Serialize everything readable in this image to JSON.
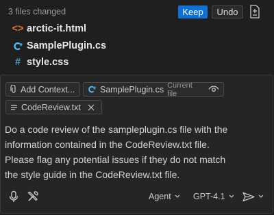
{
  "changes": {
    "label": "3 files changed",
    "keep_label": "Keep",
    "undo_label": "Undo",
    "files": [
      {
        "name": "arctic-it.html",
        "icon": "html-code-icon",
        "color": "#e37933"
      },
      {
        "name": "SamplePlugin.cs",
        "icon": "csharp-icon",
        "color": "#4fc1ff"
      },
      {
        "name": "style.css",
        "icon": "css-hash-icon",
        "color": "#519aba"
      }
    ]
  },
  "context": {
    "add_label": "Add Context...",
    "current_file_name": "SamplePlugin.cs",
    "current_file_tag": "Current file",
    "attached_file_name": "CodeReview.txt"
  },
  "prompt": {
    "lines": [
      "Do a code review of the sampleplugin.cs file with the",
      "information contained in the CodeReview.txt file.",
      "Please flag any potential issues if they do not match",
      "the style guide in the CodeReview.txt file."
    ]
  },
  "toolbar": {
    "mode_label": "Agent",
    "model_label": "GPT-4.1"
  },
  "colors": {
    "accent": "#0e71d6",
    "background": "#1f1f1f",
    "input_background": "#252526"
  }
}
